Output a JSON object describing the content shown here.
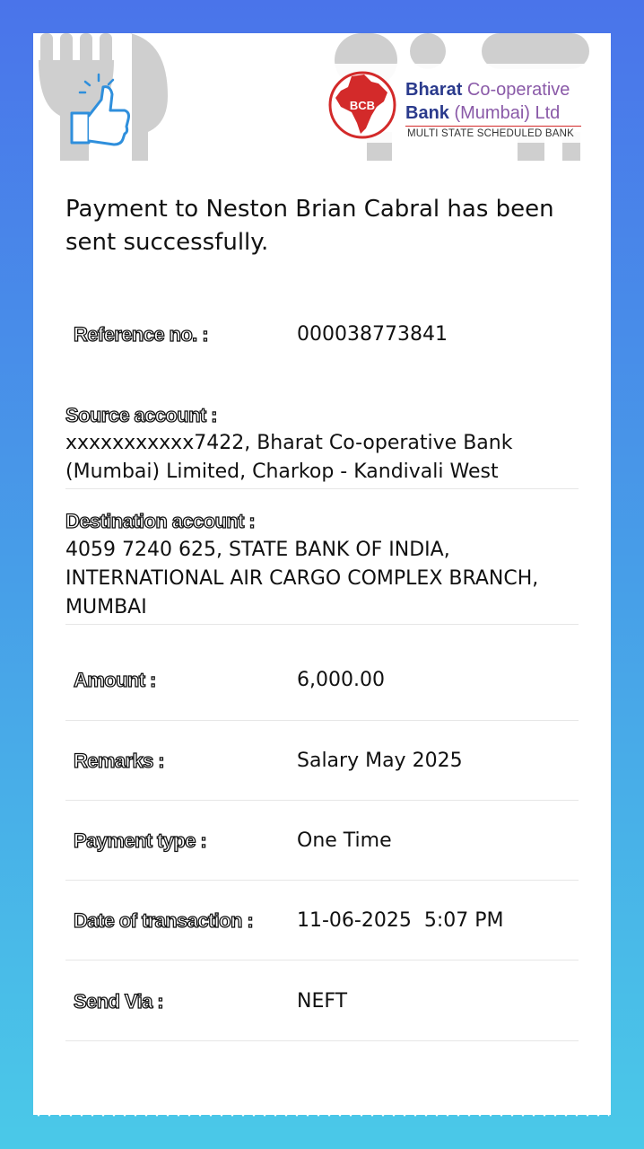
{
  "bank": {
    "name_line1_part1": "Bharat",
    "name_line1_part2": "Co-operative",
    "name_line2_part1": "Bank",
    "name_line2_part2": "(Mumbai)",
    "name_line2_part3": "Ltd",
    "tagline": "MULTI STATE SCHEDULED BANK",
    "emblem_text": "BCB"
  },
  "title": "Payment to Neston Brian Cabral has been sent successfully.",
  "fields": {
    "reference": {
      "label": "Reference no. :",
      "value": "000038773841"
    },
    "source": {
      "label": "Source account :",
      "value": "xxxxxxxxxxx7422, Bharat Co-operative Bank (Mumbai) Limited, Charkop - Kandivali West"
    },
    "destination": {
      "label": "Destination account :",
      "value": "4059 7240 625, STATE BANK OF INDIA, INTERNATIONAL AIR CARGO COMPLEX BRANCH, MUMBAI"
    },
    "amount": {
      "label": "Amount :",
      "value": "6,000.00"
    },
    "remarks": {
      "label": "Remarks :",
      "value": "Salary May 2025"
    },
    "payment_type": {
      "label": "Payment type :",
      "value": "One Time"
    },
    "date": {
      "label": "Date of transaction :",
      "value": "11-06-2025  5:07 PM"
    },
    "send_via": {
      "label": "Send Via :",
      "value": "NEFT"
    }
  },
  "colors": {
    "bg_top": "#4a74ea",
    "bg_bottom": "#4ac9e8",
    "bank_red": "#d32a2a",
    "bank_blue": "#2a3a8c",
    "thumbs_blue": "#2f8fdc"
  },
  "icons": [
    "thumbs-up-icon",
    "fork-knife-icon",
    "bank-emblem-icon"
  ]
}
